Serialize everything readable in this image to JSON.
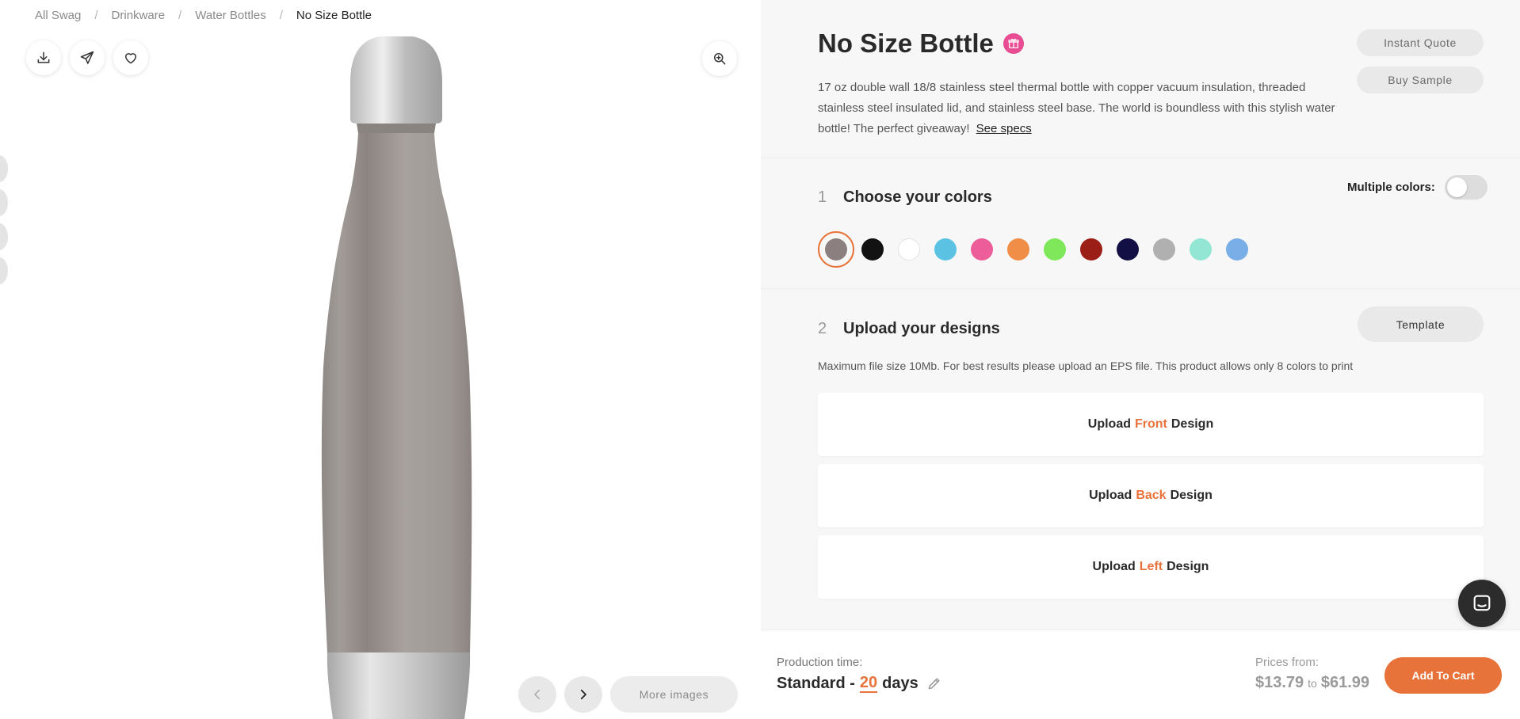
{
  "breadcrumb": {
    "items": [
      "All Swag",
      "Drinkware",
      "Water Bottles",
      "No Size Bottle"
    ],
    "separator": "/"
  },
  "toolbar": {
    "icons": [
      "download-icon",
      "send-icon",
      "heart-icon",
      "zoom-in-icon"
    ]
  },
  "gallery": {
    "more_images_label": "More images",
    "icons": [
      "chevron-left-icon",
      "chevron-right-icon"
    ]
  },
  "product": {
    "title": "No Size Bottle",
    "badge_icon": "gift-icon",
    "description": "17 oz double wall 18/8 stainless steel thermal bottle with copper vacuum insulation, threaded stainless steel insulated lid, and stainless steel base. The world is boundless with this stylish water bottle! The perfect giveaway!",
    "see_specs_label": "See specs"
  },
  "actions": {
    "instant_quote": "Instant Quote",
    "buy_sample": "Buy Sample"
  },
  "colors_step": {
    "number": "1",
    "title": "Choose your colors",
    "multiple_label": "Multiple colors:",
    "multiple_enabled": false,
    "selected_index": 0,
    "swatches": [
      "#8c7f7f",
      "#121212",
      "#ffffff",
      "#5bc2e4",
      "#ec5d9a",
      "#f08d47",
      "#7ee85a",
      "#9c1f17",
      "#120f45",
      "#b0b0b0",
      "#93e6d3",
      "#7aaee6"
    ]
  },
  "designs_step": {
    "number": "2",
    "title": "Upload your designs",
    "template_label": "Template",
    "hint": "Maximum file size 10Mb. For best results please upload an EPS file. This product allows only 8 colors to print",
    "uploads": [
      {
        "prefix": "Upload",
        "side": "Front",
        "suffix": "Design"
      },
      {
        "prefix": "Upload",
        "side": "Back",
        "suffix": "Design"
      },
      {
        "prefix": "Upload",
        "side": "Left",
        "suffix": "Design"
      }
    ]
  },
  "chat": {
    "icon": "chat-icon"
  },
  "footer": {
    "production_label": "Production time:",
    "production_type": "Standard -",
    "production_days": "20",
    "production_unit": "days",
    "edit_icon": "pencil-icon",
    "prices_label": "Prices from:",
    "price_min": "$13.79",
    "price_to": "to",
    "price_max": "$61.99",
    "cart_label": "Add To Cart"
  },
  "colors": {
    "accent": "#e8733a",
    "badge": "#e84c92",
    "panel_bg": "#f7f7f7"
  }
}
